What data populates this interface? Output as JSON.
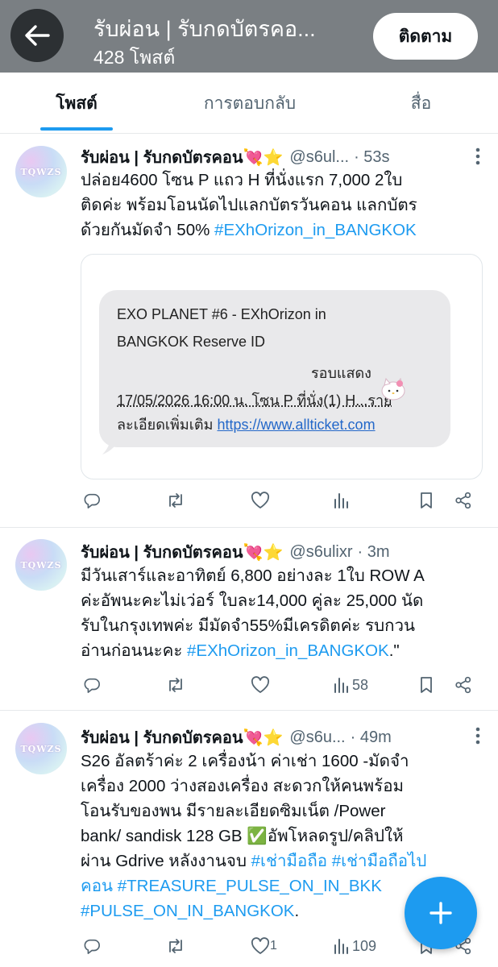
{
  "header": {
    "title": "รับผ่อน | รับกดบัตรคอ...",
    "post_count": "428 โพสต์",
    "follow_label": "ติดตาม"
  },
  "tabs": [
    {
      "label": "โพสต์",
      "active": true
    },
    {
      "label": "การตอบกลับ",
      "active": false
    },
    {
      "label": "สื่อ",
      "active": false
    }
  ],
  "avatar_text": "TQWZS",
  "colors": {
    "accent": "#1d9bf0",
    "header_bg": "#7a7f83",
    "muted": "#536471"
  },
  "posts": [
    {
      "author": "รับผ่อน | รับกดบัตรคอน💘⭐",
      "handle": "@s6ul...",
      "time": "· 53s",
      "lines": [
        "ปล่อย4600 โซน P แถว H ที่นั่งแรก 7,000  2ใบ",
        "ติดค่ะ พร้อมโอนนัดไปแลกบัตรวันคอน แลกบัตร"
      ],
      "line3_text": "ด้วยกันมัดจำ 50% ",
      "line3_tag": "#EXhOrizon_in_BANGKOK",
      "media": {
        "line1": "EXO PLANET #6 - EXhOrizon in",
        "line2": "BANGKOK Reserve ID",
        "line3": "รอบแสดง",
        "line4": "17/05/2026 16:00 น. โซน P ที่นั่ง(1) H...ราย",
        "line5_text": "ละเอียดเพิ่มเติม ",
        "line5_link": "https://www.allticket.com"
      },
      "stats": {
        "replies": "",
        "reposts": "",
        "likes": "",
        "views": ""
      }
    },
    {
      "author": "รับผ่อน | รับกดบัตรคอน💘⭐",
      "handle": "@s6ulixr",
      "time": "· 3m",
      "lines": [
        "มีวันเสาร์และอาทิตย์ 6,800 อย่างละ 1ใบ  ROW A",
        "ค่ะอัพนะคะไม่เว่อร์ ใบละ14,000 คู่ละ 25,000 นัด",
        "รับในกรุงเทพค่ะ มีมัดจำ55%มีเครดิตค่ะ รบกวน"
      ],
      "line4_text": "อ่านก่อนนะคะ ",
      "line4_tag": "#EXhOrizon_in_BANGKOK",
      "line4_tail": ".\"",
      "stats": {
        "replies": "",
        "reposts": "",
        "likes": "",
        "views": "58"
      }
    },
    {
      "author": "รับผ่อน | รับกดบัตรคอน💘⭐",
      "handle": "@s6u...",
      "time": "· 49m",
      "lines": [
        "S26 อัลตร้าค่ะ 2 เครื่องน้า ค่าเช่า 1600 -มัดจำ",
        "เครื่อง 2000  ว่างสองเครื่อง  สะดวกให้คนพร้อม",
        "โอนรับของพน มีรายละเอียดซิมเน็ต /Power",
        "bank/ sandisk 128 GB ✅อัพโหลดรูป/คลิปให้"
      ],
      "line5_text": "ผ่าน Gdrive หลังงานจบ ",
      "line5_tags": "#เช่ามือถือ #เช่ามือถือไป",
      "line6_tag": "คอน #TREASURE_PULSE_ON_IN_BKK",
      "line7_tag": "#PULSE_ON_IN_BANGKOK",
      "line7_tail": ".",
      "stats": {
        "replies": "",
        "reposts": "",
        "likes": "1",
        "views": "109"
      }
    }
  ]
}
